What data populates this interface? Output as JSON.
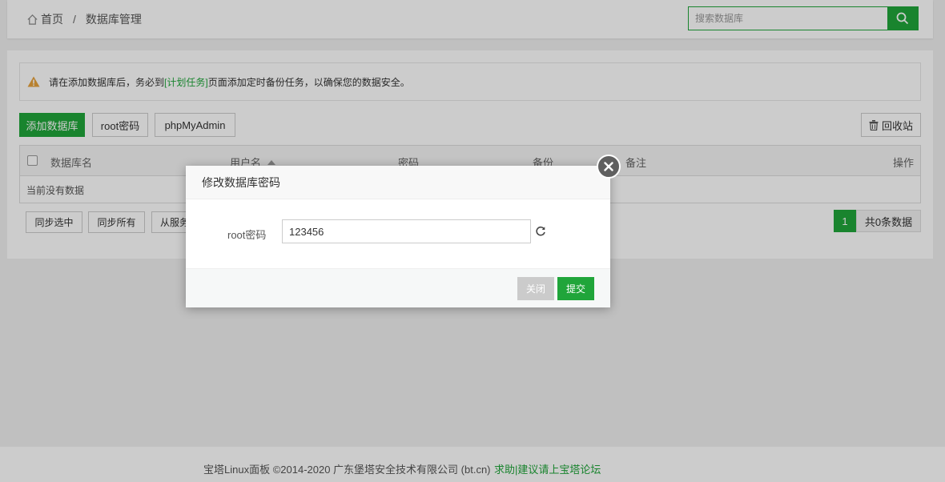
{
  "breadcrumb": {
    "home": "首页",
    "separator": "/",
    "current": "数据库管理"
  },
  "search": {
    "placeholder": "搜索数据库"
  },
  "alert": {
    "before": "请在添加数据库后，务必到",
    "link": "[计划任务]",
    "after": "页面添加定时备份任务，以确保您的数据安全。"
  },
  "toolbar": {
    "add_db": "添加数据库",
    "root_password": "root密码",
    "phpmyadmin": "phpMyAdmin",
    "recycle_bin": "回收站"
  },
  "table": {
    "columns": [
      "数据库名",
      "用户名",
      "密码",
      "备份",
      "备注",
      "操作"
    ],
    "empty_text": "当前没有数据"
  },
  "bulk": {
    "sync_selected": "同步选中",
    "sync_all": "同步所有",
    "from_server": "从服务"
  },
  "pagination": {
    "current": "1",
    "total": "共0条数据"
  },
  "modal": {
    "title": "修改数据库密码",
    "field_label": "root密码",
    "field_value": "123456",
    "close_label": "关闭",
    "submit_label": "提交"
  },
  "footer": {
    "copyright": "宝塔Linux面板 ©2014-2020 广东堡塔安全技术有限公司 (bt.cn)",
    "help_link": "求助|建议请上宝塔论坛"
  },
  "colors": {
    "accent": "#20a53a",
    "warning": "#e6a23c"
  },
  "icons": [
    "home-icon",
    "search-icon",
    "warning-icon",
    "trash-icon",
    "close-icon",
    "refresh-icon"
  ]
}
